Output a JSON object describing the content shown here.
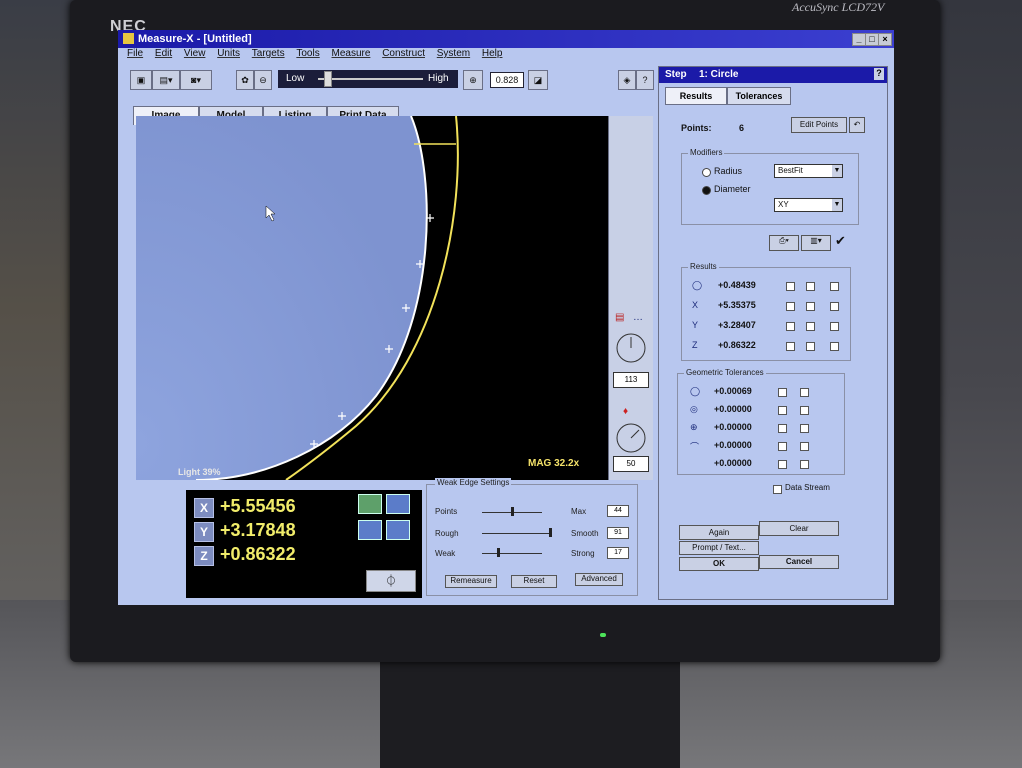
{
  "monitor": {
    "brand_left": "NEC",
    "brand_right": "AccuSync LCD72V"
  },
  "window": {
    "title": "Measure-X - [Untitled]"
  },
  "menu": [
    "File",
    "Edit",
    "View",
    "Units",
    "Targets",
    "Tools",
    "Measure",
    "Construct",
    "System",
    "Help"
  ],
  "toolbar": {
    "slider_low": "Low",
    "slider_high": "High",
    "zoom_value": "0.828"
  },
  "tabs": [
    "Image",
    "Model",
    "Listing",
    "Print Data"
  ],
  "image": {
    "light_label": "Light 39%",
    "mag_label": "MAG 32.2x",
    "strip_value_1": "113",
    "strip_value_2": "50"
  },
  "dro": {
    "x_label": "X",
    "y_label": "Y",
    "z_label": "Z",
    "x": "+5.55456",
    "y": "+3.17848",
    "z": "+0.86322"
  },
  "weak_edge": {
    "title": "Weak Edge Settings",
    "points": "Points",
    "rough": "Rough",
    "weak": "Weak",
    "max": "Max",
    "smooth": "Smooth",
    "strong": "Strong",
    "max_val": "44",
    "smooth_val": "91",
    "strong_val": "17",
    "remeasure": "Remeasure",
    "reset": "Reset",
    "advanced": "Advanced"
  },
  "step": {
    "title": "Step",
    "name": "1: Circle",
    "help": "?",
    "tab_results": "Results",
    "tab_tolerances": "Tolerances",
    "points_label": "Points:",
    "points_value": "6",
    "edit_points": "Edit Points",
    "modifiers_title": "Modifiers",
    "radius": "Radius",
    "diameter": "Diameter",
    "fit_value": "BestFit",
    "plane_value": "XY",
    "results_title": "Results",
    "results": [
      {
        "icon": "circle-icon",
        "axis": "",
        "value": "+0.48439"
      },
      {
        "icon": "x-axis-icon",
        "axis": "X",
        "value": "+5.35375"
      },
      {
        "icon": "y-axis-icon",
        "axis": "Y",
        "value": "+3.28407"
      },
      {
        "icon": "z-axis-icon",
        "axis": "Z",
        "value": "+0.86322"
      }
    ],
    "geo_title": "Geometric Tolerances",
    "geo": [
      "+0.00069",
      "+0.00000",
      "+0.00000",
      "+0.00000",
      "+0.00000"
    ],
    "data_stream": "Data Stream",
    "again": "Again",
    "clear": "Clear",
    "prompt": "Prompt / Text...",
    "ok": "OK",
    "cancel": "Cancel"
  },
  "colors": {
    "titlebar": "#1b1aa8",
    "dro_text": "#f1ec6a",
    "panel_bg": "#b8c7ef",
    "edge_yellow": "#f2e25a"
  }
}
